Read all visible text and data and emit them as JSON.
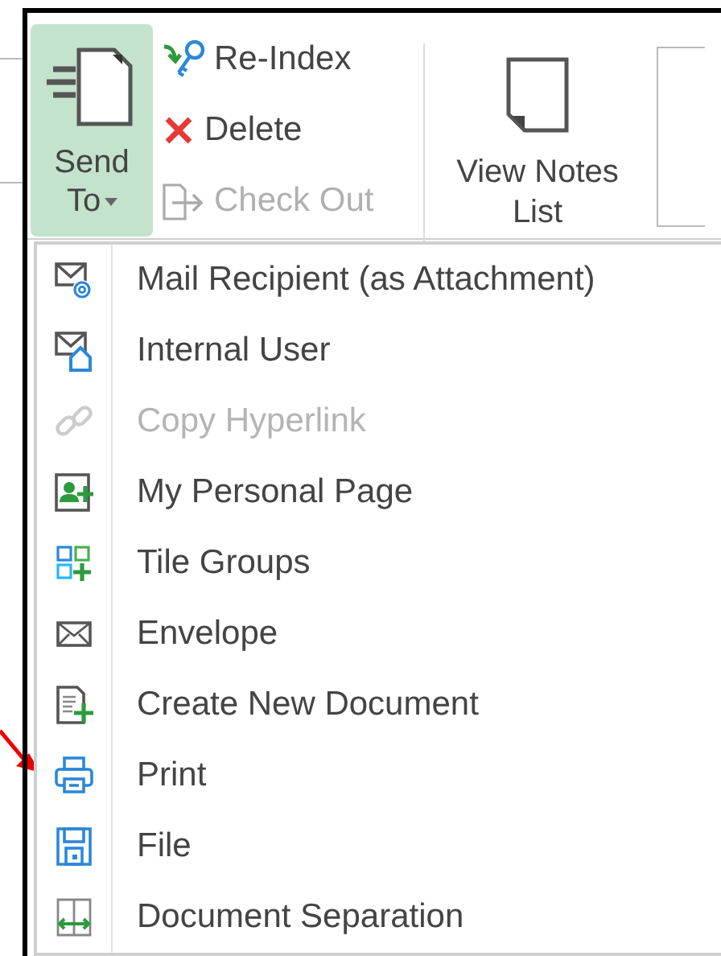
{
  "ribbon": {
    "send_to": {
      "label_line_1": "Send",
      "label_line_2": "To",
      "selected": true
    },
    "actions": [
      {
        "label": "Re-Index",
        "disabled": false
      },
      {
        "label": "Delete",
        "disabled": false
      },
      {
        "label": "Check Out",
        "disabled": true
      }
    ],
    "view_notes": {
      "label_line_1": "View Notes",
      "label_line_2": "List"
    }
  },
  "menu": {
    "items": [
      {
        "label": "Mail Recipient (as Attachment)",
        "disabled": false
      },
      {
        "label": "Internal User",
        "disabled": false
      },
      {
        "label": "Copy Hyperlink",
        "disabled": true
      },
      {
        "label": "My Personal Page",
        "disabled": false
      },
      {
        "label": "Tile Groups",
        "disabled": false
      },
      {
        "label": "Envelope",
        "disabled": false
      },
      {
        "label": "Create New Document",
        "disabled": false
      },
      {
        "label": "Print",
        "disabled": false
      },
      {
        "label": "File",
        "disabled": false
      },
      {
        "label": "Document Separation",
        "disabled": false
      }
    ]
  }
}
